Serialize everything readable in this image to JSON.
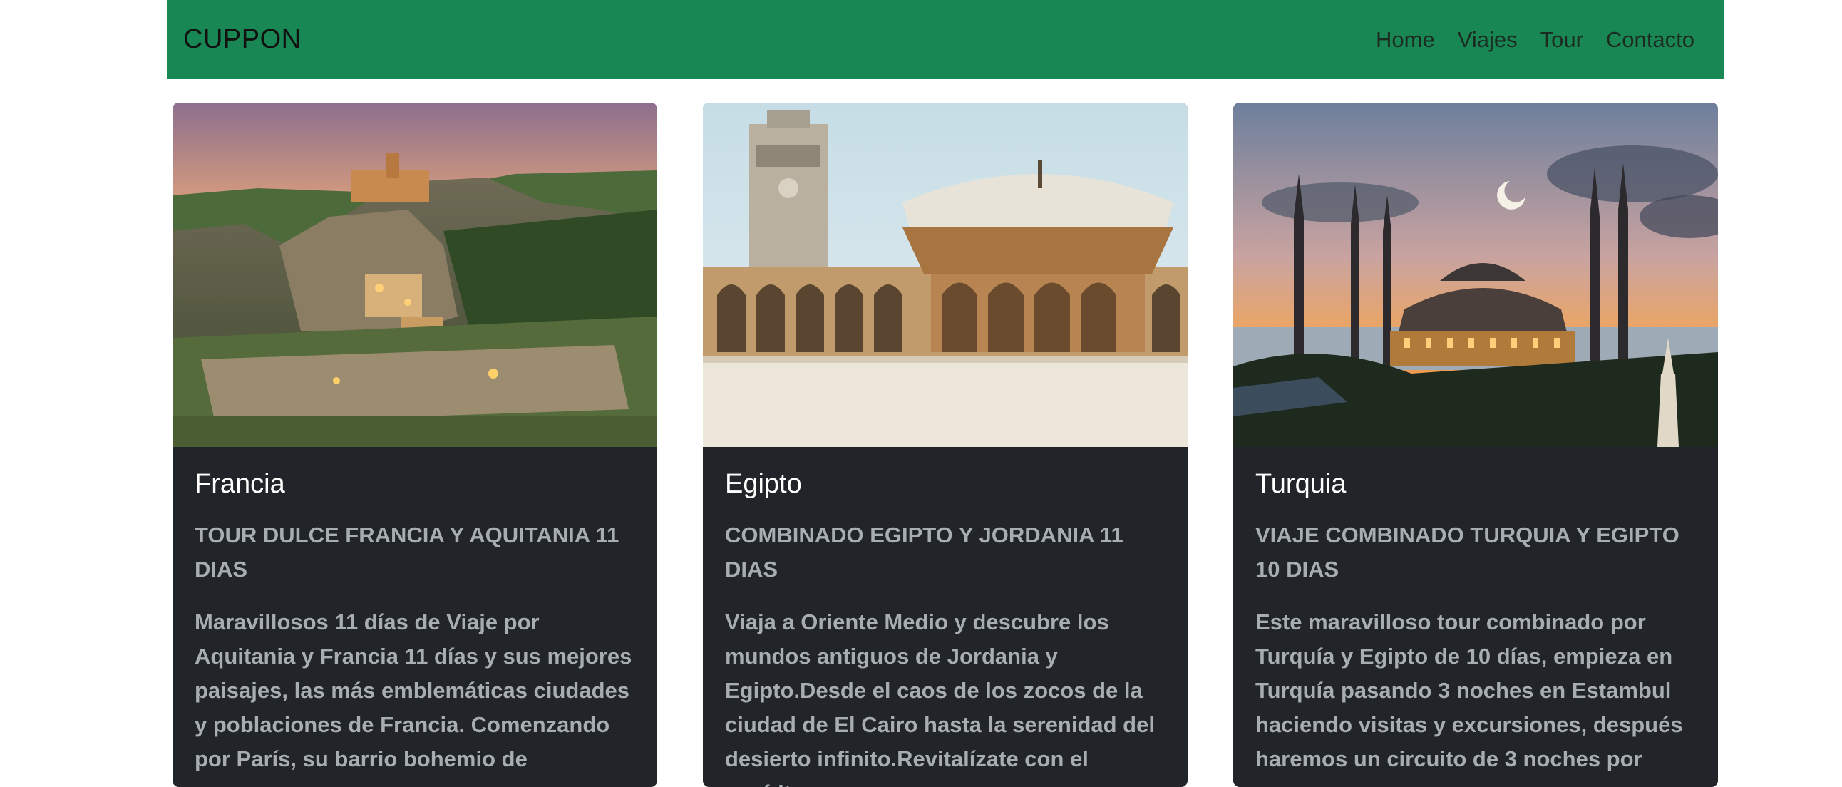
{
  "navbar": {
    "brand": "CUPPON",
    "links": [
      "Home",
      "Viajes",
      "Tour",
      "Contacto"
    ],
    "background": "#198754"
  },
  "cards": [
    {
      "title": "Francia",
      "subtitle": "TOUR DULCE FRANCIA Y AQUITANIA 11 DIAS",
      "text": "Maravillosos 11 días de Viaje por Aquitania y Francia 11 días y sus mejores paisajes, las más emblemáticas ciudades y poblaciones de Francia. Comenzando por París, su barrio bohemio de",
      "image": "hilltop-village-photo"
    },
    {
      "title": "Egipto",
      "subtitle": "COMBINADO EGIPTO Y JORDANIA 11 DIAS",
      "text": "Viaja a Oriente Medio y descubre los mundos antiguos de Jordania y Egipto.Desde el caos de los zocos de la ciudad de El Cairo hasta la serenidad del desierto infinito.Revitalízate con el espíritu",
      "image": "mosque-courtyard-photo"
    },
    {
      "title": "Turquia",
      "subtitle": "VIAJE COMBINADO TURQUIA Y EGIPTO 10 DIAS",
      "text": "Este maravilloso tour combinado por Turquía y Egipto de 10 días, empieza en Turquía pasando 3 noches en Estambul haciendo visitas y excursiones, después haremos un circuito de 3 noches por",
      "image": "mosque-sunset-photo"
    }
  ]
}
